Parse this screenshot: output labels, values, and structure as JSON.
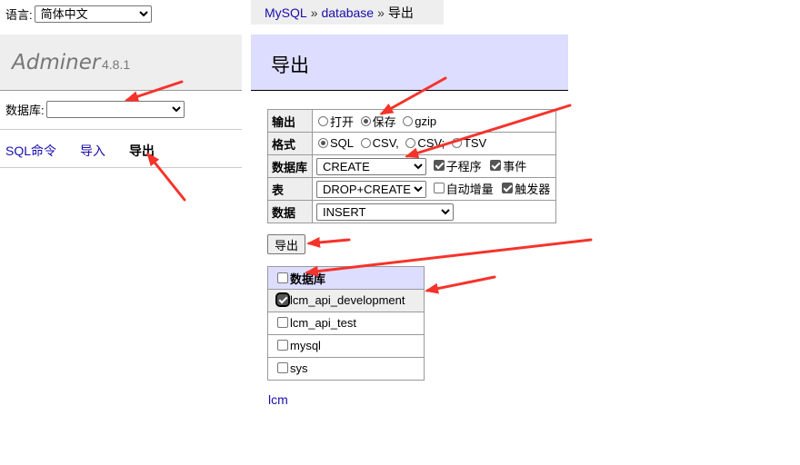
{
  "sidebar": {
    "language_label": "语言:",
    "language_value": "简体中文",
    "app_name": "Adminer",
    "app_version": "4.8.1",
    "database_label": "数据库:",
    "database_value": "",
    "links": [
      "SQL命令",
      "导入",
      "导出"
    ],
    "active_link": "导出"
  },
  "breadcrumb": {
    "items": [
      "MySQL",
      "database",
      "导出"
    ],
    "separator": "»"
  },
  "page": {
    "title": "导出",
    "submit_label": "导出",
    "footer_link": "lcm"
  },
  "options": {
    "output": {
      "label": "输出",
      "choices": [
        "打开",
        "保存",
        "gzip"
      ],
      "selected": "保存"
    },
    "format": {
      "label": "格式",
      "choices": [
        "SQL",
        "CSV,",
        "CSV;",
        "TSV"
      ],
      "selected": "SQL"
    },
    "database": {
      "label": "数据库",
      "select": "CREATE",
      "checks": [
        {
          "label": "子程序",
          "checked": true
        },
        {
          "label": "事件",
          "checked": true
        }
      ]
    },
    "table": {
      "label": "表",
      "select": "DROP+CREATE",
      "checks": [
        {
          "label": "自动增量",
          "checked": false
        },
        {
          "label": "触发器",
          "checked": true
        }
      ]
    },
    "data": {
      "label": "数据",
      "select": "INSERT"
    }
  },
  "databases": {
    "header": "数据库",
    "header_checked": false,
    "rows": [
      {
        "name": "lcm_api_development",
        "checked": true
      },
      {
        "name": "lcm_api_test",
        "checked": false
      },
      {
        "name": "mysql",
        "checked": false
      },
      {
        "name": "sys",
        "checked": false
      }
    ]
  },
  "colors": {
    "accent": "#ddf",
    "annotation": "#f5332b",
    "link": "#1a0dab"
  }
}
